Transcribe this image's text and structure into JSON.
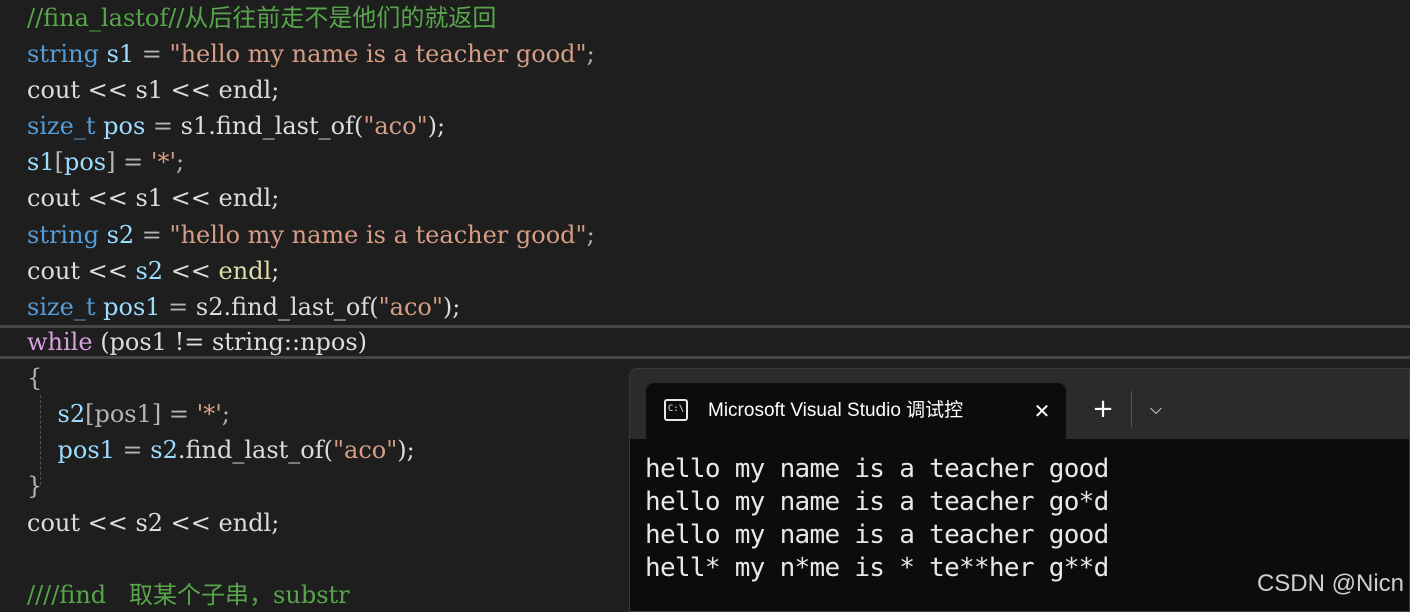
{
  "editor": {
    "lines": [
      [
        {
          "t": "//fina_lastof//从后往前走不是他们的就返回",
          "c": "cmt"
        }
      ],
      [
        {
          "t": "string",
          "c": "kw"
        },
        {
          "t": " ",
          "c": "op"
        },
        {
          "t": "s1",
          "c": "var"
        },
        {
          "t": " = ",
          "c": "op"
        },
        {
          "t": "\"hello my name is a teacher good\"",
          "c": "str"
        },
        {
          "t": ";",
          "c": "op"
        }
      ],
      [
        {
          "t": "cout << s1 << endl;",
          "c": "plain"
        }
      ],
      [
        {
          "t": "size_t",
          "c": "kw"
        },
        {
          "t": " ",
          "c": "op"
        },
        {
          "t": "pos",
          "c": "var"
        },
        {
          "t": " = ",
          "c": "op"
        },
        {
          "t": "s1.find_last_of(",
          "c": "plain"
        },
        {
          "t": "\"aco\"",
          "c": "str"
        },
        {
          "t": ");",
          "c": "plain"
        }
      ],
      [
        {
          "t": "s1",
          "c": "var"
        },
        {
          "t": "[",
          "c": "op"
        },
        {
          "t": "pos",
          "c": "var"
        },
        {
          "t": "] = ",
          "c": "op"
        },
        {
          "t": "'*'",
          "c": "str"
        },
        {
          "t": ";",
          "c": "op"
        }
      ],
      [
        {
          "t": "cout << s1 << endl;",
          "c": "plain"
        }
      ],
      [
        {
          "t": "string",
          "c": "kw"
        },
        {
          "t": " ",
          "c": "op"
        },
        {
          "t": "s2",
          "c": "var"
        },
        {
          "t": " = ",
          "c": "op"
        },
        {
          "t": "\"hello my name is a teacher good\"",
          "c": "str"
        },
        {
          "t": ";",
          "c": "op"
        }
      ],
      [
        {
          "t": "cout << ",
          "c": "plain"
        },
        {
          "t": "s2",
          "c": "var"
        },
        {
          "t": " << ",
          "c": "plain"
        },
        {
          "t": "endl",
          "c": "fn"
        },
        {
          "t": ";",
          "c": "plain"
        }
      ],
      [
        {
          "t": "size_t",
          "c": "kw"
        },
        {
          "t": " ",
          "c": "op"
        },
        {
          "t": "pos1",
          "c": "var"
        },
        {
          "t": " = ",
          "c": "op"
        },
        {
          "t": "s2.find_last_of(",
          "c": "plain"
        },
        {
          "t": "\"aco\"",
          "c": "str"
        },
        {
          "t": ");",
          "c": "plain"
        }
      ],
      [
        {
          "t": "while",
          "c": "kw2"
        },
        {
          "t": " (pos1 != string::npos)",
          "c": "plain"
        }
      ],
      [
        {
          "t": "{",
          "c": "op"
        }
      ],
      [
        {
          "t": "    ",
          "c": "op"
        },
        {
          "t": "s2",
          "c": "var"
        },
        {
          "t": "[pos1] = ",
          "c": "op"
        },
        {
          "t": "'*'",
          "c": "str"
        },
        {
          "t": ";",
          "c": "op"
        }
      ],
      [
        {
          "t": "    ",
          "c": "op"
        },
        {
          "t": "pos1",
          "c": "var"
        },
        {
          "t": " = ",
          "c": "op"
        },
        {
          "t": "s2",
          "c": "var"
        },
        {
          "t": ".find_last_of(",
          "c": "plain"
        },
        {
          "t": "\"aco\"",
          "c": "str"
        },
        {
          "t": ");",
          "c": "plain"
        }
      ],
      [
        {
          "t": "}",
          "c": "op"
        }
      ],
      [
        {
          "t": "cout << s2 << endl;",
          "c": "plain"
        }
      ],
      [
        {
          "t": "",
          "c": "plain"
        }
      ],
      [
        {
          "t": "////find   取某个子串，substr",
          "c": "cmt"
        }
      ]
    ]
  },
  "terminal": {
    "tab_title": "Microsoft Visual Studio 调试控",
    "tab_icon": "terminal-icon",
    "close_glyph": "✕",
    "new_tab_glyph": "+",
    "dropdown_glyph": "⌵",
    "output": [
      "hello my name is a teacher good",
      "hello my name is a teacher go*d",
      "hello my name is a teacher good",
      "hell* my n*me is * te**her g**d"
    ]
  },
  "watermark": "CSDN @Nicn",
  "colors": {
    "background": "#1e1e1e",
    "keyword": "#569cd6",
    "control_keyword": "#d8a0df",
    "variable": "#9cdcfe",
    "string": "#d69d85",
    "comment": "#57a64a",
    "terminal_bg": "#0c0c0c"
  }
}
